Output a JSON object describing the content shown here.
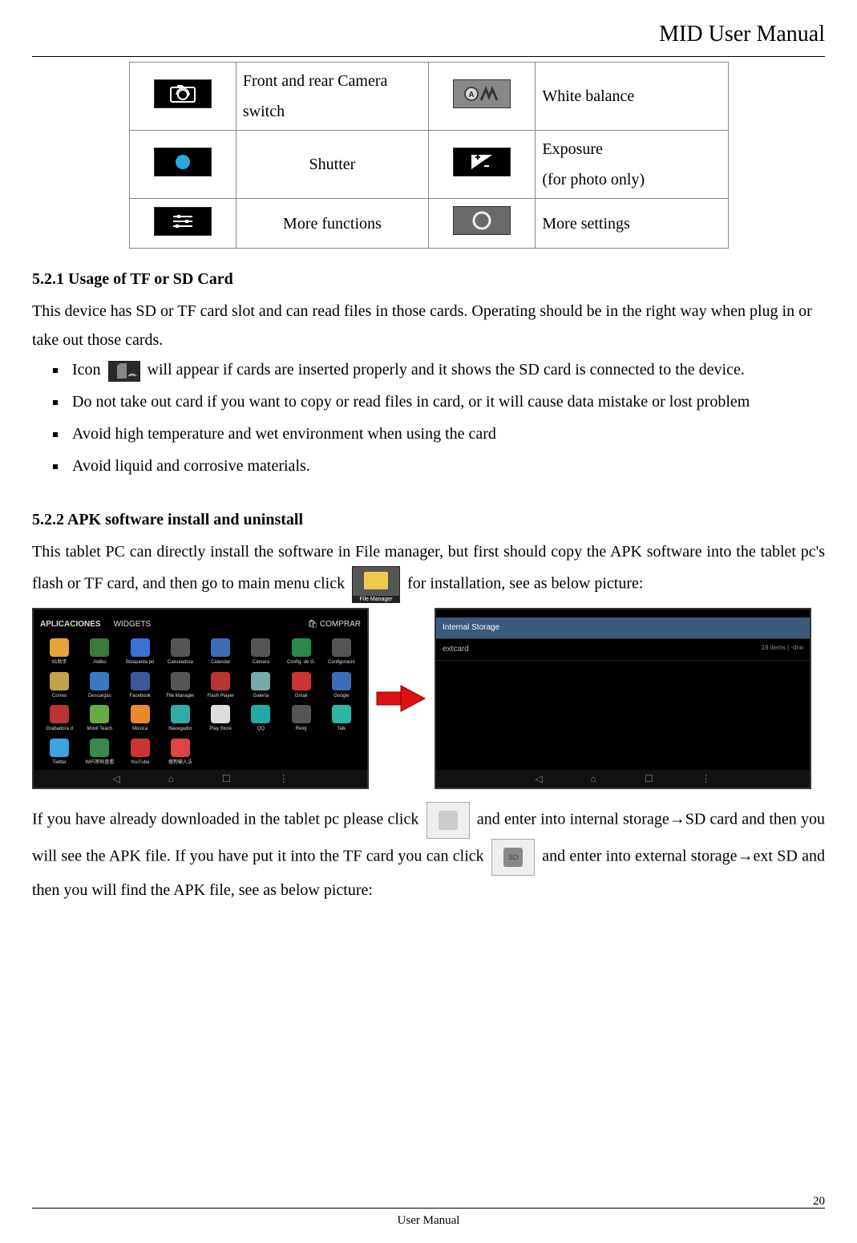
{
  "header": {
    "title": "MID User Manual"
  },
  "iconTable": {
    "rows": [
      {
        "left": {
          "icon_name": "camera-switch-icon",
          "desc": "Front and rear Camera switch"
        },
        "right": {
          "icon_name": "white-balance-icon",
          "desc": "White balance"
        }
      },
      {
        "left": {
          "icon_name": "shutter-icon",
          "desc": "Shutter"
        },
        "right": {
          "icon_name": "exposure-icon",
          "desc_line1": "Exposure",
          "desc_line2": "(for photo only)"
        }
      },
      {
        "left": {
          "icon_name": "more-functions-icon",
          "desc": "More functions"
        },
        "right": {
          "icon_name": "more-settings-icon",
          "desc": "More settings"
        }
      }
    ]
  },
  "section_521": {
    "heading": "5.2.1 Usage of TF or SD Card",
    "intro": "This device has SD or TF card slot and can read files in those cards. Operating should be in the right way when plug in or take out those cards.",
    "bullet1_before": "Icon",
    "bullet1_after": "will appear if cards are inserted properly and it shows the SD card is connected to the device.",
    "bullet2": "Do not take out card if you want to copy or read files in card, or it will cause data mistake or lost problem",
    "bullet3": "Avoid high temperature and wet environment when using the card",
    "bullet4": "Avoid liquid and corrosive materials."
  },
  "section_522": {
    "heading": "5.2.2 APK software install and uninstall",
    "para1_before": "This tablet PC can directly install the software in File manager, but first should copy the APK software into the tablet pc's flash or TF card, and then go to main menu click",
    "para1_after": "for installation, see as below picture:",
    "para2_before": "If you have already downloaded in the tablet pc please click",
    "para2_mid": "and enter into internal storage→SD card and then you will see the APK file. If you have put it into the TF card you can click",
    "para2_after": "and enter into external storage→ext SD and then you will find the APK file, see as below picture:"
  },
  "screens": {
    "apps_screen": {
      "tab1": "APLICACIONES",
      "tab2": "WIDGETS",
      "tab_right": "COMPRAR",
      "apps": [
        {
          "label": "91助手",
          "color": "#e8a23a"
        },
        {
          "label": "Aldiko",
          "color": "#3a7a3a"
        },
        {
          "label": "Búsqueda po",
          "color": "#3b6fd6"
        },
        {
          "label": "Calculadora",
          "color": "#555"
        },
        {
          "label": "Calendar",
          "color": "#3a6db5"
        },
        {
          "label": "Cámara",
          "color": "#555"
        },
        {
          "label": "Config. de G.",
          "color": "#2a884b"
        },
        {
          "label": "Configuració",
          "color": "#555"
        },
        {
          "label": "Correo",
          "color": "#c4a24a"
        },
        {
          "label": "Descargas",
          "color": "#3a7ac2"
        },
        {
          "label": "Facebook",
          "color": "#3b5998"
        },
        {
          "label": "File Manager",
          "color": "#555"
        },
        {
          "label": "Flash Player",
          "color": "#b33"
        },
        {
          "label": "Galería",
          "color": "#7aa"
        },
        {
          "label": "Gmail",
          "color": "#c33"
        },
        {
          "label": "Google",
          "color": "#3a6db5"
        },
        {
          "label": "Grabadora d",
          "color": "#b33"
        },
        {
          "label": "Movil Teach",
          "color": "#6a4"
        },
        {
          "label": "Música",
          "color": "#e88b2a"
        },
        {
          "label": "Navegador",
          "color": "#3aa"
        },
        {
          "label": "Play Store",
          "color": "#ddd"
        },
        {
          "label": "QQ",
          "color": "#2aa"
        },
        {
          "label": "Reloj",
          "color": "#555"
        },
        {
          "label": "Talk",
          "color": "#2ab5a5"
        },
        {
          "label": "Twitter",
          "color": "#3aa3e0"
        },
        {
          "label": "WiFi密码查看",
          "color": "#3a884b"
        },
        {
          "label": "YouTube",
          "color": "#c33"
        },
        {
          "label": "搜狗输入法",
          "color": "#d44"
        }
      ]
    },
    "fm_screen": {
      "row1": "Internal Storage",
      "row2": "extcard",
      "row2_right": "19 items | -drw"
    }
  },
  "footer": {
    "center": "User Manual",
    "page": "20"
  }
}
